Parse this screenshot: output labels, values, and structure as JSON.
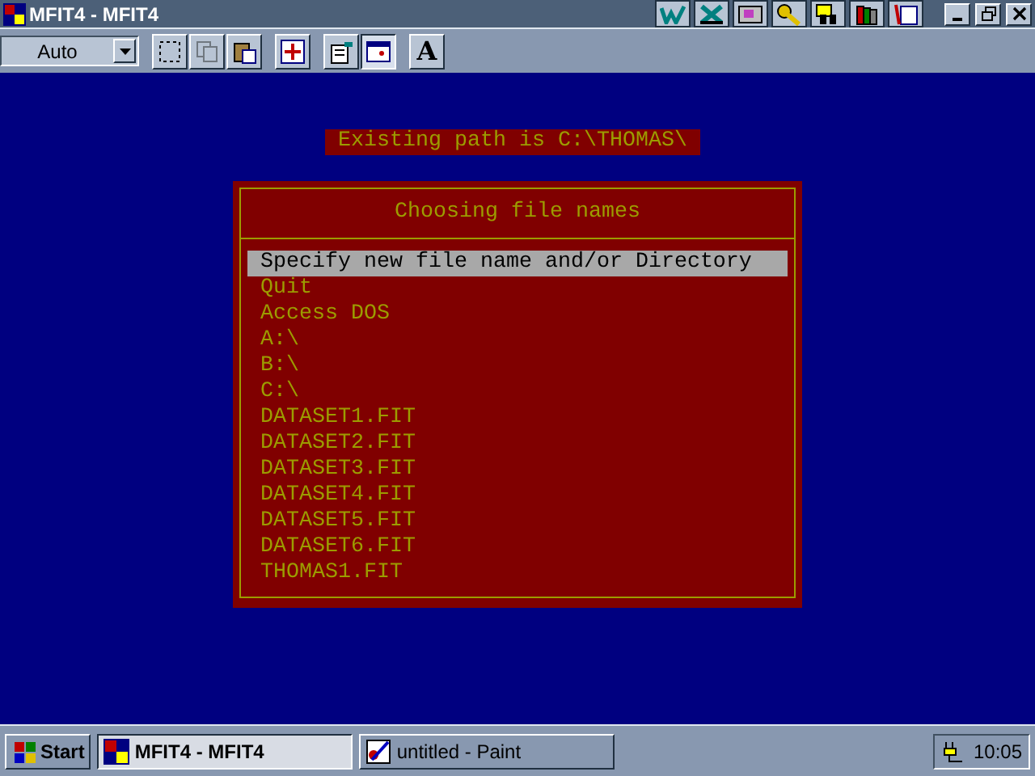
{
  "window": {
    "title": "MFIT4 - MFIT4"
  },
  "quick_launch": [
    {
      "kind": "w"
    },
    {
      "kind": "x"
    },
    {
      "kind": "photo"
    },
    {
      "kind": "key"
    },
    {
      "kind": "binoculars"
    },
    {
      "kind": "books"
    },
    {
      "kind": "notes"
    }
  ],
  "toolbar": {
    "zoom_select": "Auto",
    "buttons": [
      {
        "kind": "select",
        "pressed": false,
        "disabled": false
      },
      {
        "kind": "copy",
        "pressed": false,
        "disabled": true
      },
      {
        "kind": "paste",
        "pressed": false,
        "disabled": false
      },
      {
        "kind": "fullscreen",
        "pressed": false,
        "disabled": false
      },
      {
        "kind": "properties",
        "pressed": false,
        "disabled": false
      },
      {
        "kind": "background",
        "pressed": true,
        "disabled": false
      },
      {
        "kind": "font",
        "label": "A",
        "pressed": false,
        "disabled": false
      }
    ]
  },
  "console": {
    "path_label": "Existing path is C:\\THOMAS\\",
    "dialog": {
      "title": "Choosing file names",
      "items": [
        {
          "label": "Specify new file name and/or Directory",
          "selected": true
        },
        {
          "label": "Quit",
          "selected": false
        },
        {
          "label": "Access DOS",
          "selected": false
        },
        {
          "label": "A:\\",
          "selected": false
        },
        {
          "label": "B:\\",
          "selected": false
        },
        {
          "label": "C:\\",
          "selected": false
        },
        {
          "label": "DATASET1.FIT",
          "selected": false
        },
        {
          "label": "DATASET2.FIT",
          "selected": false
        },
        {
          "label": "DATASET3.FIT",
          "selected": false
        },
        {
          "label": "DATASET4.FIT",
          "selected": false
        },
        {
          "label": "DATASET5.FIT",
          "selected": false
        },
        {
          "label": "DATASET6.FIT",
          "selected": false
        },
        {
          "label": "THOMAS1.FIT",
          "selected": false
        }
      ]
    }
  },
  "taskbar": {
    "start": "Start",
    "tasks": [
      {
        "label": "MFIT4 - MFIT4",
        "selected": true,
        "kind": "dos"
      },
      {
        "label": "untitled - Paint",
        "selected": false,
        "kind": "paint"
      }
    ],
    "clock": "10:05"
  }
}
